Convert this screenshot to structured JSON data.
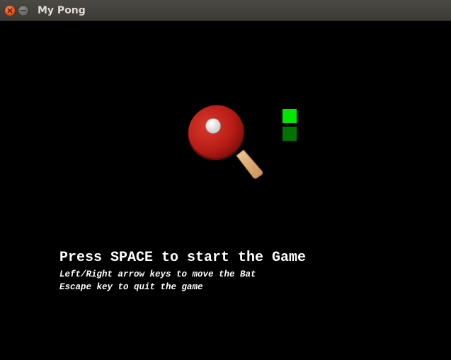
{
  "window": {
    "title": "My Pong",
    "close_icon": "close-icon",
    "minimize_icon": "minimize-icon"
  },
  "splash": {
    "logo_icon": "ping-pong-paddle-icon",
    "headline": "Press SPACE to start the Game",
    "hints": [
      "Left/Right arrow keys to move the Bat",
      "Escape key to quit the game"
    ]
  },
  "colors": {
    "background": "#000000",
    "block_bright": "#00e600",
    "block_dark": "#007300",
    "paddle_red": "#c0221a",
    "paddle_handle": "#e0b07a"
  }
}
